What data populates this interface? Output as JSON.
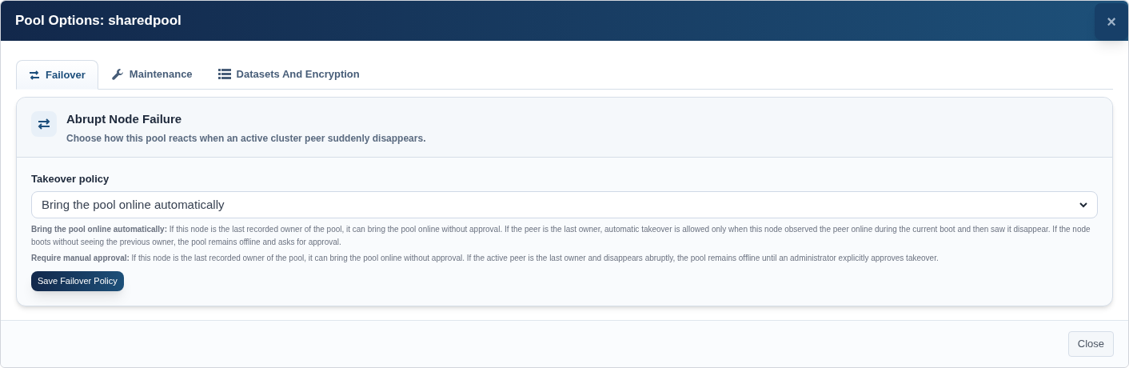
{
  "window": {
    "title": "Pool Options: sharedpool",
    "close_glyph": "×"
  },
  "tabs": [
    {
      "label": "Failover",
      "kind": "swap",
      "selected": true
    },
    {
      "label": "Maintenance",
      "kind": "wrench",
      "selected": false
    },
    {
      "label": "Datasets And Encryption",
      "kind": "list",
      "selected": false
    }
  ],
  "section": {
    "title": "Abrupt Node Failure",
    "subtitle": "Choose how this pool reacts when an active cluster peer suddenly disappears."
  },
  "field": {
    "label": "Takeover policy",
    "value": "Bring the pool online automatically"
  },
  "help": [
    "**Bring the pool online automatically:** If this node is the last recorded owner of the pool, it can bring the pool online without approval. If the peer is the last owner, automatic takeover is allowed only when this node observed the peer online during the current boot and then saw it disappear. If the node boots without seeing the previous owner, the pool remains offline and asks for approval.",
    "**Require manual approval:** If this node is the last recorded owner of the pool, it can bring the pool online without approval. If the active peer is the last owner and disappears abruptly, the pool remains offline until an administrator explicitly approves takeover."
  ],
  "save_button": "Save Failover Policy",
  "footer_button": "Close"
}
